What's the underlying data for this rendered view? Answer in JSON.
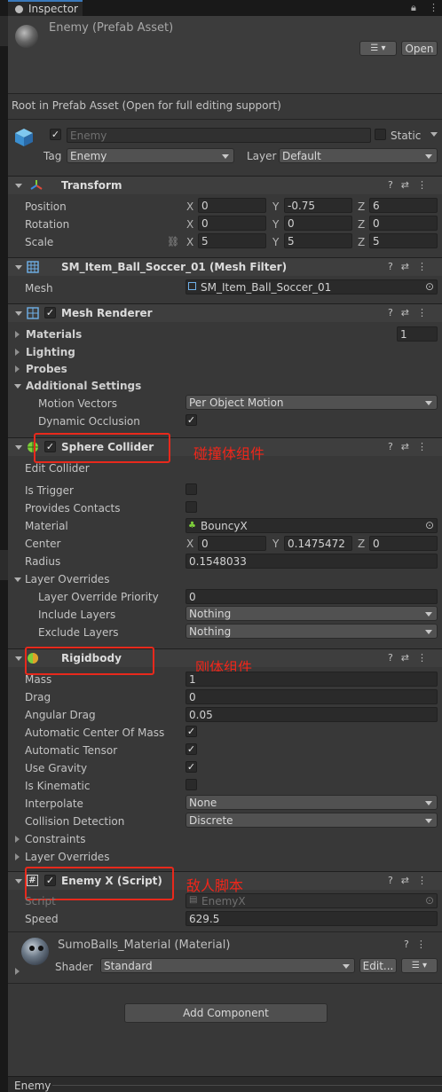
{
  "tab": {
    "title": "Inspector"
  },
  "header": {
    "name": "Enemy (Prefab Asset)",
    "open_label": "Open",
    "note": "Root in Prefab Asset (Open for full editing support)"
  },
  "gameobject": {
    "name": "Enemy",
    "static_label": "Static",
    "tag_label": "Tag",
    "tag_value": "Enemy",
    "layer_label": "Layer",
    "layer_value": "Default"
  },
  "transform": {
    "title": "Transform",
    "position_label": "Position",
    "rotation_label": "Rotation",
    "scale_label": "Scale",
    "position": {
      "x": "0",
      "y": "-0.75",
      "z": "6"
    },
    "rotation": {
      "x": "0",
      "y": "0",
      "z": "0"
    },
    "scale": {
      "x": "5",
      "y": "5",
      "z": "5"
    }
  },
  "axes": {
    "x": "X",
    "y": "Y",
    "z": "Z"
  },
  "mesh_filter": {
    "title": "SM_Item_Ball_Soccer_01 (Mesh Filter)",
    "mesh_label": "Mesh",
    "mesh_value": "SM_Item_Ball_Soccer_01"
  },
  "mesh_renderer": {
    "title": "Mesh Renderer",
    "materials_label": "Materials",
    "materials_count": "1",
    "lighting_label": "Lighting",
    "probes_label": "Probes",
    "additional_label": "Additional Settings",
    "motion_vectors_label": "Motion Vectors",
    "motion_vectors_value": "Per Object Motion",
    "dynamic_occlusion_label": "Dynamic Occlusion"
  },
  "sphere_collider": {
    "title": "Sphere Collider",
    "edit_collider": "Edit Collider",
    "is_trigger_label": "Is Trigger",
    "provides_contacts_label": "Provides Contacts",
    "material_label": "Material",
    "material_value": "BouncyX",
    "center_label": "Center",
    "center": {
      "x": "0",
      "y": "0.1475472",
      "z": "0"
    },
    "radius_label": "Radius",
    "radius_value": "0.1548033",
    "layer_overrides_label": "Layer Overrides",
    "priority_label": "Layer Override Priority",
    "priority_value": "0",
    "include_label": "Include Layers",
    "include_value": "Nothing",
    "exclude_label": "Exclude Layers",
    "exclude_value": "Nothing"
  },
  "rigidbody": {
    "title": "Rigidbody",
    "mass_label": "Mass",
    "mass_value": "1",
    "drag_label": "Drag",
    "drag_value": "0",
    "angular_drag_label": "Angular Drag",
    "angular_drag_value": "0.05",
    "auto_center_label": "Automatic Center Of Mass",
    "auto_tensor_label": "Automatic Tensor",
    "use_gravity_label": "Use Gravity",
    "is_kinematic_label": "Is Kinematic",
    "interpolate_label": "Interpolate",
    "interpolate_value": "None",
    "collision_label": "Collision Detection",
    "collision_value": "Discrete",
    "constraints_label": "Constraints",
    "layer_overrides_label": "Layer Overrides"
  },
  "script": {
    "title": "Enemy X (Script)",
    "script_label": "Script",
    "script_value": "EnemyX",
    "speed_label": "Speed",
    "speed_value": "629.5"
  },
  "material": {
    "title": "SumoBalls_Material (Material)",
    "shader_label": "Shader",
    "shader_value": "Standard",
    "edit_label": "Edit..."
  },
  "add_component": "Add Component",
  "annotations": {
    "collider": "碰撞体组件",
    "rigidbody": "刚体组件",
    "script": "敌人脚本"
  },
  "footer": {
    "label": "Enemy"
  },
  "colors": {
    "annotation": "#e8291c",
    "tab_accent": "#3a79bb",
    "background": "#383838"
  }
}
